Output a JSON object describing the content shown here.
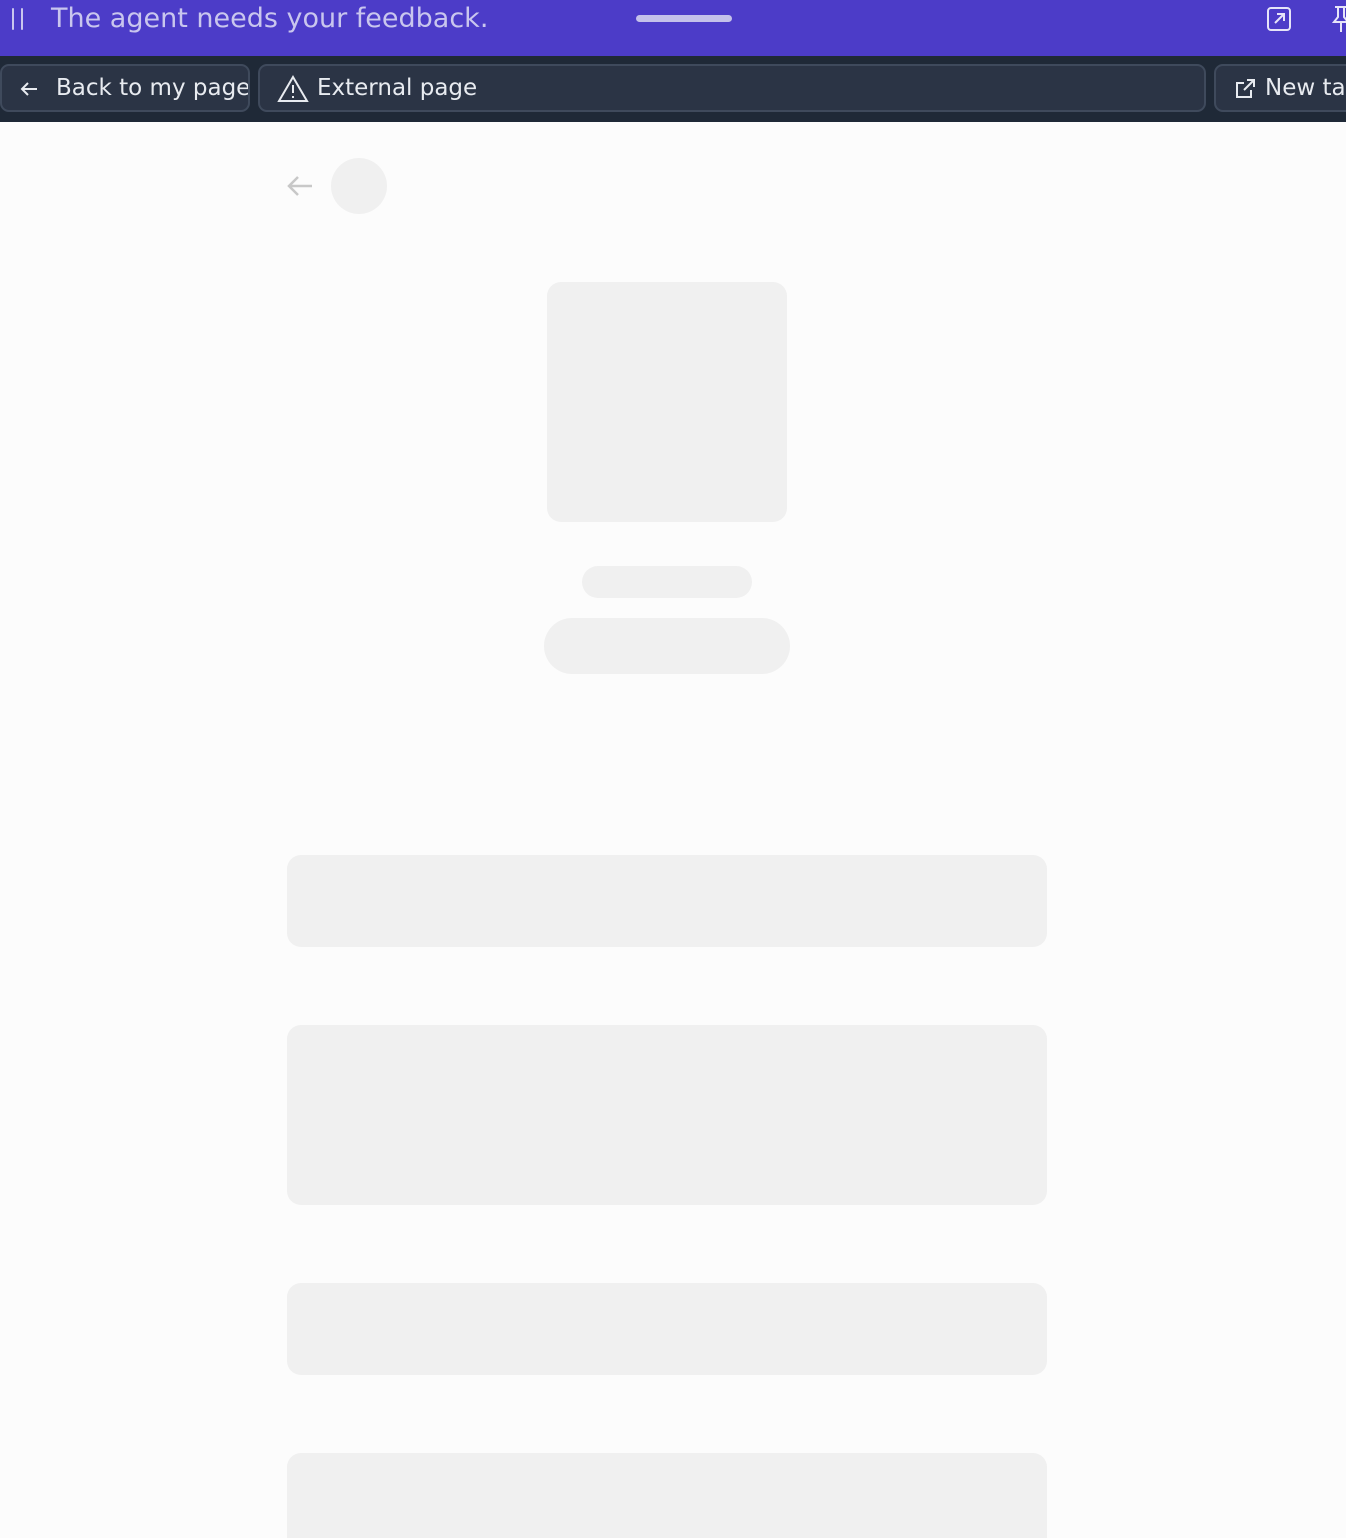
{
  "agent_bar": {
    "message": "The agent needs your feedback.",
    "icons": [
      "pause-icon",
      "drag-handle",
      "expand-icon",
      "pin-icon"
    ]
  },
  "tabs": [
    {
      "label": "Back to my page",
      "icon": "arrow-left-icon"
    },
    {
      "label": "External page",
      "icon": "warning-icon"
    },
    {
      "label": "New tab",
      "icon": "external-link-icon"
    }
  ],
  "colors": {
    "agent_bar_bg": "#4c3cc8",
    "tab_bar_bg": "#1f2937",
    "skeleton": "#f0f0f0",
    "page_bg": "#fcfcfc"
  }
}
